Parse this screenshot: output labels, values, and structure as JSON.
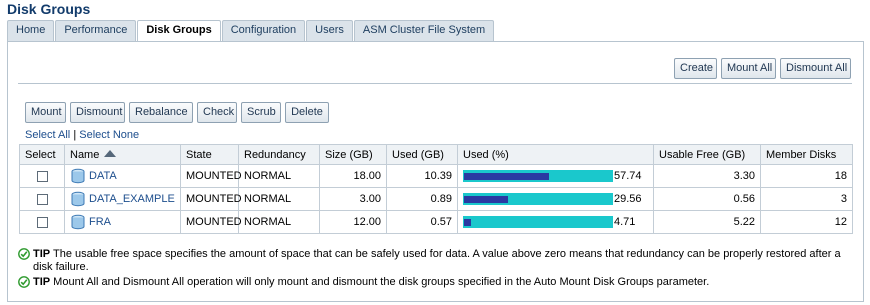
{
  "page": {
    "title": "Disk Groups"
  },
  "tabs": [
    {
      "label": "Home"
    },
    {
      "label": "Performance"
    },
    {
      "label": "Disk Groups",
      "active": true
    },
    {
      "label": "Configuration"
    },
    {
      "label": "Users"
    },
    {
      "label": "ASM Cluster File System"
    }
  ],
  "top_buttons": {
    "create": "Create",
    "mount_all": "Mount All",
    "dismount_all": "Dismount All"
  },
  "action_buttons": {
    "mount": "Mount",
    "dismount": "Dismount",
    "rebalance": "Rebalance",
    "check": "Check",
    "scrub": "Scrub",
    "delete": "Delete"
  },
  "selection": {
    "select_all": "Select All",
    "separator": "|",
    "select_none": "Select None"
  },
  "table": {
    "headers": {
      "select": "Select",
      "name": "Name",
      "state": "State",
      "redundancy": "Redundancy",
      "size": "Size (GB)",
      "used": "Used (GB)",
      "used_pct": "Used (%)",
      "usable_free": "Usable Free (GB)",
      "member_disks": "Member Disks"
    },
    "rows": [
      {
        "name": "DATA",
        "state": "MOUNTED",
        "redundancy": "NORMAL",
        "size": "18.00",
        "used": "10.39",
        "used_pct": "57.74",
        "used_fraction": 0.5774,
        "usable_free": "3.30",
        "member_disks": "18"
      },
      {
        "name": "DATA_EXAMPLE",
        "state": "MOUNTED",
        "redundancy": "NORMAL",
        "size": "3.00",
        "used": "0.89",
        "used_pct": "29.56",
        "used_fraction": 0.2956,
        "usable_free": "0.56",
        "member_disks": "3"
      },
      {
        "name": "FRA",
        "state": "MOUNTED",
        "redundancy": "NORMAL",
        "size": "12.00",
        "used": "0.57",
        "used_pct": "4.71",
        "used_fraction": 0.0471,
        "usable_free": "5.22",
        "member_disks": "12"
      }
    ]
  },
  "tips": [
    {
      "label": "TIP",
      "text": " The usable free space specifies the amount of space that can be safely used for data. A value above zero means that redundancy can be properly restored after a disk failure."
    },
    {
      "label": "TIP",
      "text": " Mount All and Dismount All operation will only mount and dismount the disk groups specified in the Auto Mount Disk Groups parameter."
    }
  ],
  "colors": {
    "bar_track": "#1ac8cc",
    "bar_fill": "#2a3aa2",
    "link": "#1d4e8d",
    "title": "#123b6b",
    "tip_check": "#2e9a2e"
  },
  "icons": {
    "disk_group": "disk-group-icon",
    "sort": "sort-ascending-icon",
    "tip": "tip-check-icon"
  }
}
